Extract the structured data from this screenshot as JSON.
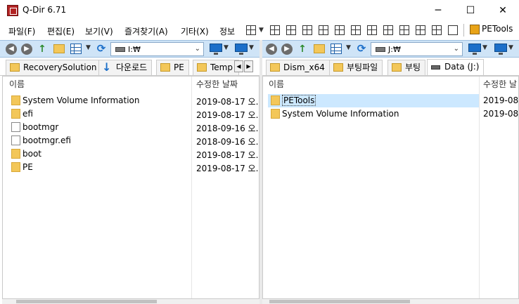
{
  "window": {
    "title": "Q-Dir 6.71",
    "minimize": "─",
    "maximize": "☐",
    "close": "✕"
  },
  "menu": {
    "items": [
      "파일(F)",
      "편집(E)",
      "보기(V)",
      "즐겨찾기(A)",
      "기타(X)",
      "정보"
    ],
    "petools_label": "PETools"
  },
  "left": {
    "address": "I:₩",
    "tabs": [
      {
        "label": "RecoverySolution",
        "icon": "folder-icon"
      },
      {
        "label": "다운로드",
        "icon": "download-arrow-icon"
      },
      {
        "label": "PE",
        "icon": "folder-icon"
      },
      {
        "label": "Temp",
        "icon": "folder-icon"
      }
    ],
    "columns": {
      "name": "이름",
      "date": "수정한 날짜"
    },
    "files": [
      {
        "name": "System Volume Information",
        "date": "2019-08-17 오...",
        "type": "folder"
      },
      {
        "name": "efi",
        "date": "2019-08-17 오...",
        "type": "folder"
      },
      {
        "name": "bootmgr",
        "date": "2018-09-16 오...",
        "type": "file"
      },
      {
        "name": "bootmgr.efi",
        "date": "2018-09-16 오...",
        "type": "file"
      },
      {
        "name": "boot",
        "date": "2019-08-17 오...",
        "type": "folder"
      },
      {
        "name": "PE",
        "date": "2019-08-17 오...",
        "type": "folder"
      }
    ]
  },
  "right": {
    "address": "J:₩",
    "tabs": [
      {
        "label": "Dism_x64",
        "icon": "folder-icon"
      },
      {
        "label": "부팅파일",
        "icon": "folder-icon"
      },
      {
        "label": "부팅",
        "icon": "folder-icon"
      },
      {
        "label": "Data (J:)",
        "icon": "drive-icon",
        "active": true
      }
    ],
    "columns": {
      "name": "이름",
      "date": "수정한 날"
    },
    "files": [
      {
        "name": "PETools",
        "date": "2019-08",
        "type": "folder",
        "selected": true
      },
      {
        "name": "System Volume Information",
        "date": "2019-08",
        "type": "folder"
      }
    ]
  },
  "colors": {
    "toolbar_bg": "#cfe4f7",
    "selection": "#cce8ff",
    "folder": "#f3c759",
    "app_icon": "#b22222"
  }
}
